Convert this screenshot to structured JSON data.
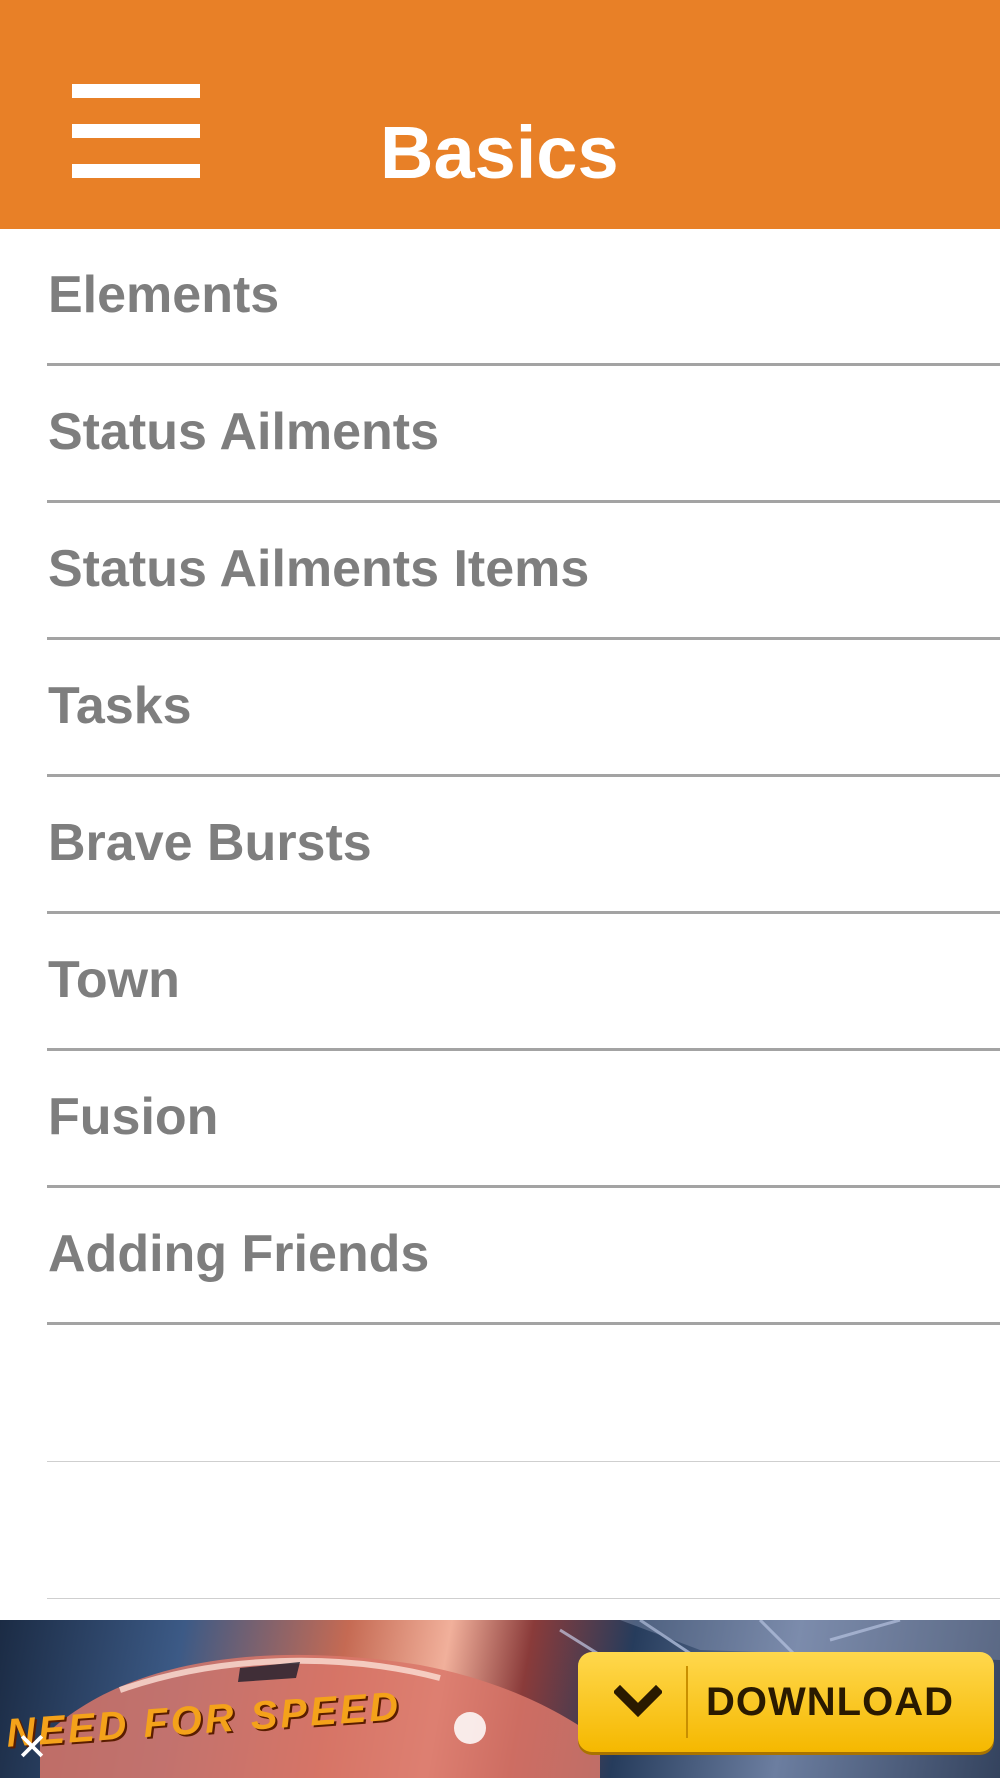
{
  "header": {
    "title": "Basics",
    "menu_icon": "hamburger-menu-icon",
    "background_color": "#e88027"
  },
  "list": {
    "items": [
      {
        "label": "Elements"
      },
      {
        "label": "Status Ailments"
      },
      {
        "label": "Status Ailments Items"
      },
      {
        "label": "Tasks"
      },
      {
        "label": "Brave Bursts"
      },
      {
        "label": "Town"
      },
      {
        "label": "Fusion"
      },
      {
        "label": "Adding Friends"
      }
    ],
    "text_color": "#7e7e7e",
    "divider_color": "#a3a3a3"
  },
  "ad": {
    "logo_text": "NEED FOR SPEED",
    "download_label": "DOWNLOAD",
    "close_icon": "close-icon",
    "download_icon": "chevron-down-icon",
    "button_color": "#f5b800"
  }
}
